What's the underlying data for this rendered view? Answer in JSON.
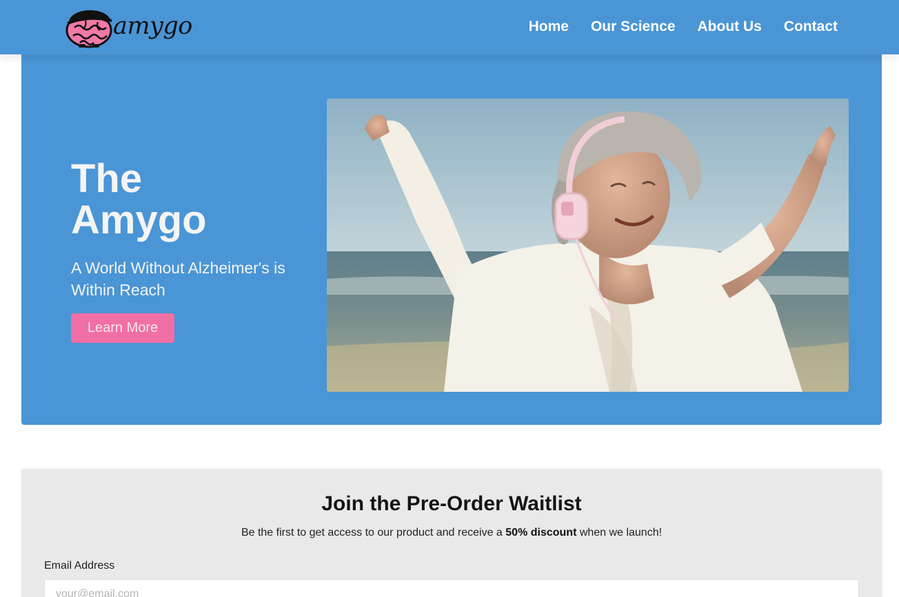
{
  "brand": {
    "name": "amygo",
    "colors": {
      "nav": "#4a95d6",
      "accent": "#f06fa4",
      "brain": "#f07aa6"
    },
    "logo_icon": "brain-cap-icon"
  },
  "nav": {
    "links": [
      "Home",
      "Our Science",
      "About Us",
      "Contact"
    ]
  },
  "hero": {
    "title_line1": "The",
    "title_line2": "Amygo",
    "subtitle": "A World Without Alzheimer's is Within Reach",
    "cta_label": "Learn More",
    "image_icon": "woman-with-headphones-beach-photo"
  },
  "waitlist": {
    "title": "Join the Pre-Order Waitlist",
    "desc_before": "Be the first to get access to our product and receive a ",
    "desc_bold": "50% discount",
    "desc_after": " when we launch!",
    "email_label": "Email Address",
    "email_placeholder": "your@email.com",
    "email_value": ""
  }
}
